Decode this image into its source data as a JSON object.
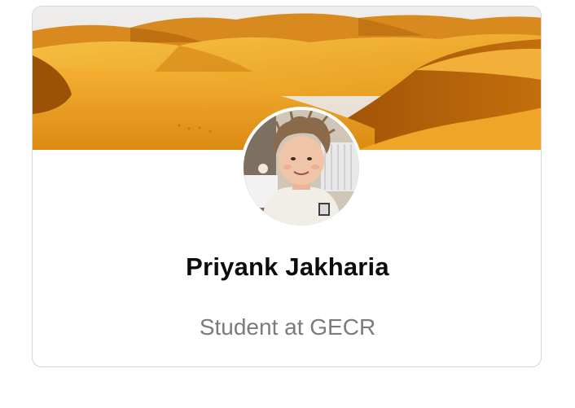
{
  "profile": {
    "name": "Priyank Jakharia",
    "headline": "Student at GECR"
  },
  "cover": {
    "icon": "desert-dunes-image"
  },
  "avatar": {
    "icon": "profile-photo-avatar"
  },
  "colors": {
    "card_border": "#d6d6d6",
    "name_text": "#0c0c0c",
    "headline_text": "#7b7b7b",
    "sand_light": "#f3b53a",
    "sand_dark": "#b86808",
    "sky": "#e8e6e4"
  }
}
